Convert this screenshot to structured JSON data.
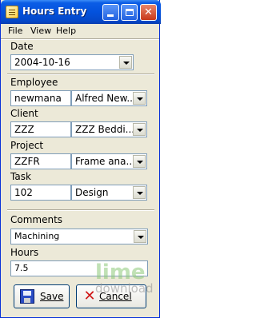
{
  "window": {
    "title": "Hours Entry"
  },
  "titlebar_buttons": {
    "minimize": "minimize",
    "maximize": "maximize",
    "close": "close"
  },
  "menu": {
    "file": "File",
    "view": "View",
    "help": "Help"
  },
  "date": {
    "label": "Date",
    "value": "2004-10-16"
  },
  "employee": {
    "label": "Employee",
    "code": "newmana",
    "name": "Alfred New..."
  },
  "client": {
    "label": "Client",
    "code": "ZZZ",
    "name": "ZZZ Beddi..."
  },
  "project": {
    "label": "Project",
    "code": "ZZFR",
    "name": "Frame ana..."
  },
  "task": {
    "label": "Task",
    "code": "102",
    "name": "Design"
  },
  "comments": {
    "label": "Comments",
    "value": "Machining"
  },
  "hours": {
    "label": "Hours",
    "value": "7.5"
  },
  "buttons": {
    "save": "Save",
    "cancel": "Cancel"
  },
  "watermark": {
    "top": "lime",
    "bottom": "download"
  }
}
